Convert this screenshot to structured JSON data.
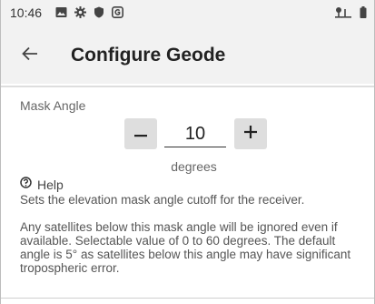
{
  "status_bar": {
    "time": "10:46",
    "left_icons": [
      "image-icon",
      "gear-icon",
      "shield-icon",
      "app-badge-icon"
    ],
    "right_icons": [
      "gps-location-icon",
      "battery-icon"
    ]
  },
  "app_bar": {
    "title": "Configure Geode",
    "background": "#f2f2f2"
  },
  "mask_angle": {
    "label": "Mask Angle",
    "value": "10",
    "decrement_label": "−",
    "increment_label": "+",
    "units": "degrees"
  },
  "help": {
    "label": "Help",
    "paragraphs": [
      "Sets the elevation mask angle cutoff for the receiver.",
      "Any satellites below this mask angle will be ignored even if available. Selectable value of 0 to 60 degrees. The default angle is 5° as satellites below this angle may have significant tropospheric error."
    ]
  }
}
